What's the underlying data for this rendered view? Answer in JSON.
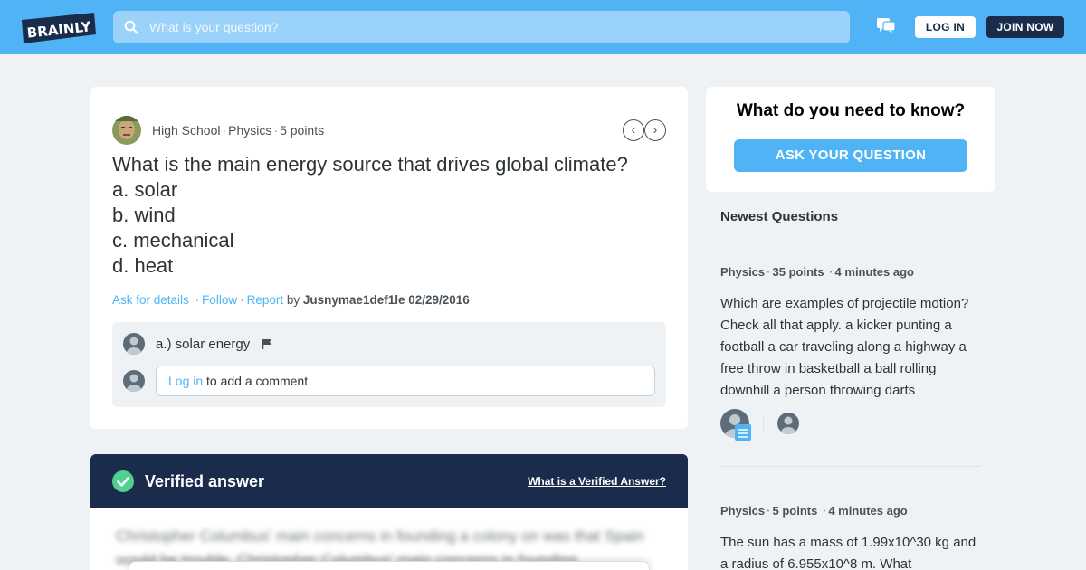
{
  "header": {
    "logo_text": "BRAINLY",
    "search_placeholder": "What is your question?",
    "login_label": "LOG IN",
    "join_label": "JOIN NOW",
    "brand_color": "#4fb3f6",
    "dark_color": "#1a2b4b"
  },
  "question": {
    "grade": "High School",
    "subject": "Physics",
    "points": "5 points",
    "title": "What is the main energy source that drives global climate?",
    "options": [
      "a. solar",
      "b. wind",
      "c. mechanical",
      "d. heat"
    ],
    "actions": {
      "ask_details": "Ask for details",
      "follow": "Follow",
      "report": "Report",
      "by": "by",
      "author": "Jusnymae1def1le",
      "date": "02/29/2016"
    },
    "comment": "a.) solar energy",
    "comment_login_link": "Log in",
    "comment_login_rest": " to add a comment"
  },
  "verified": {
    "title": "Verified answer",
    "link": "What is a Verified Answer?",
    "blurred_text": "Christopher Columbus' main concerns in founding a colony on was that Spain would be trouble. Christopher Columbus' main concerns in founding"
  },
  "sidebar": {
    "ask_title": "What do you need to know?",
    "ask_button": "ASK YOUR QUESTION",
    "newest_title": "Newest Questions",
    "questions": [
      {
        "subject": "Physics",
        "points": "35 points",
        "time": "4 minutes ago",
        "text": "Which are examples of projectile motion? Check all that apply. a kicker punting a football a car traveling along a highway a free throw in basketball a ball rolling downhill a person throwing darts"
      },
      {
        "subject": "Physics",
        "points": "5 points",
        "time": "4 minutes ago",
        "text": "The sun has a mass of 1.99x10^30 kg and a radius of 6.955x10^8 m. What"
      }
    ]
  }
}
